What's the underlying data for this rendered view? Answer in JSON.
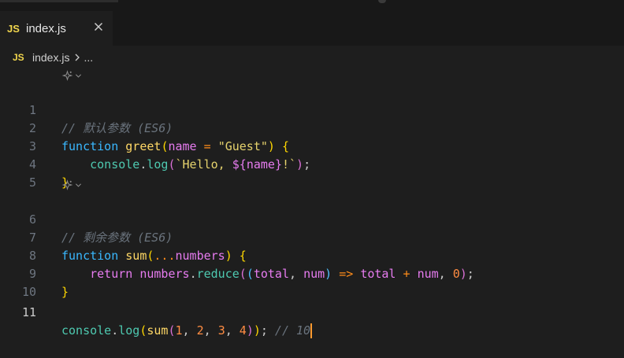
{
  "tab": {
    "icon_label": "JS",
    "label": "index.js"
  },
  "breadcrumb": {
    "icon_label": "JS",
    "file": "index.js",
    "more": "..."
  },
  "lines": [
    {
      "num": "1",
      "text": "// 默认参数 (ES6)"
    },
    {
      "num": "2",
      "text": "function greet(name = \"Guest\") {"
    },
    {
      "num": "3",
      "text": "    console.log(`Hello, ${name}!`);"
    },
    {
      "num": "4",
      "text": "}"
    },
    {
      "num": "5",
      "text": ""
    },
    {
      "num": "6",
      "text": "// 剩余参数 (ES6)"
    },
    {
      "num": "7",
      "text": "function sum(...numbers) {"
    },
    {
      "num": "8",
      "text": "    return numbers.reduce((total, num) => total + num, 0);"
    },
    {
      "num": "9",
      "text": "}"
    },
    {
      "num": "10",
      "text": ""
    },
    {
      "num": "11",
      "text": "console.log(sum(1, 2, 3, 4)); // 10"
    }
  ],
  "tokens": {
    "c1": "// 默认参数 (ES6)",
    "l2_function": "function",
    "l2_greet": "greet",
    "l2_open": "(",
    "l2_name": "name",
    "l2_eq": " = ",
    "l2_str": "\"Guest\"",
    "l2_close": ")",
    "l2_brace": " {",
    "l3_indent": "    ",
    "l3_console": "console",
    "l3_dot": ".",
    "l3_log": "log",
    "l3_open": "(",
    "l3_tpl1": "`Hello, ",
    "l3_interp_open": "${",
    "l3_name": "name",
    "l3_interp_close": "}",
    "l3_tpl2": "!`",
    "l3_close": ")",
    "l3_semi": ";",
    "l4_brace": "}",
    "c6": "// 剩余参数 (ES6)",
    "l7_function": "function",
    "l7_sum": "sum",
    "l7_open": "(",
    "l7_spread": "...",
    "l7_numbers": "numbers",
    "l7_close": ")",
    "l7_brace": " {",
    "l8_indent": "    ",
    "l8_return": "return",
    "l8_numbers": "numbers",
    "l8_dot": ".",
    "l8_reduce": "reduce",
    "l8_open1": "(",
    "l8_open2": "(",
    "l8_total": "total",
    "l8_comma1": ", ",
    "l8_num": "num",
    "l8_close2": ")",
    "l8_arrow": "=>",
    "l8_total2": "total",
    "l8_plus": "+",
    "l8_num2": "num",
    "l8_comma2": ", ",
    "l8_zero": "0",
    "l8_close1": ")",
    "l8_semi": ";",
    "l9_brace": "}",
    "l11_console": "console",
    "l11_dot": ".",
    "l11_log": "log",
    "l11_open1": "(",
    "l11_sum": "sum",
    "l11_open2": "(",
    "l11_1": "1",
    "l11_c1": ", ",
    "l11_2": "2",
    "l11_c2": ", ",
    "l11_3": "3",
    "l11_c3": ", ",
    "l11_4": "4",
    "l11_close2": ")",
    "l11_close1": ")",
    "l11_semi": ";",
    "l11_comment": " // 10"
  },
  "icons": {
    "js_file": "js-icon",
    "close": "close-icon",
    "breadcrumb_separator": "chevron-right-icon",
    "codelens": "ai-sparkle-icon"
  },
  "colors": {
    "background": "#1e1e1e",
    "tab_bar": "#181818",
    "keyword": "#3ab8ff",
    "function": "#ffd866",
    "parameter": "#e77cf0",
    "string": "#e6d36d",
    "comment": "#6a737d",
    "number": "#ff8c42",
    "cursor": "#ff9a2f"
  },
  "status": {
    "active_line": "11"
  }
}
